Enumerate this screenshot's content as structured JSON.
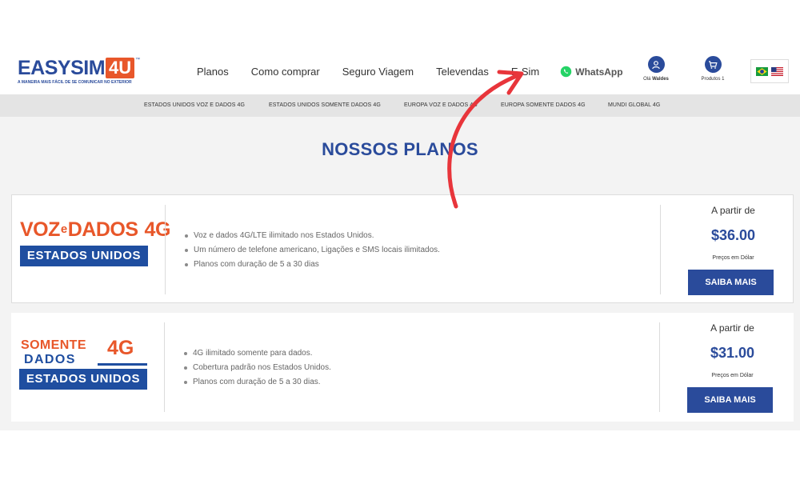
{
  "colors": {
    "brand_blue": "#2a4b9b",
    "brand_orange": "#e8572a",
    "arrow_red": "#e8353b",
    "whatsapp_green": "#25d366"
  },
  "logo": {
    "part1": "EASYSIM",
    "part2": "4U",
    "tm": "™",
    "tagline": "A MANEIRA MAIS FÁCIL DE SE COMUNICAR NO EXTERIOR"
  },
  "nav": {
    "items": [
      "Planos",
      "Como comprar",
      "Seguro Viagem",
      "Televendas",
      "E-Sim"
    ],
    "whatsapp": {
      "label": "WhatsApp",
      "icon": "whatsapp-icon"
    }
  },
  "account": {
    "greeting": "Olá",
    "name": "Waldes",
    "icon": "user-icon"
  },
  "cart": {
    "label": "Produtos 1",
    "icon": "cart-icon"
  },
  "flags": [
    "brazil-flag-icon",
    "usa-flag-icon"
  ],
  "categories": [
    "ESTADOS UNIDOS VOZ E DADOS 4G",
    "ESTADOS UNIDOS SOMENTE DADOS 4G",
    "EUROPA VOZ E DADOS 4G",
    "EUROPA SOMENTE DADOS 4G",
    "MUNDI GLOBAL 4G"
  ],
  "page_title": "NOSSOS PLANOS",
  "plans": [
    {
      "logo": {
        "voz": "VOZ",
        "e": "e",
        "dados": "DADOS",
        "g": "4G",
        "band": "ESTADOS UNIDOS"
      },
      "features": [
        "Voz e dados 4G/LTE ilimitado nos Estados Unidos.",
        "Um número de telefone americano, Ligações e SMS locais ilimitados.",
        "Planos com duração de 5 a 30 dias"
      ],
      "price_from": "A partir de",
      "price": "$36.00",
      "price_note": "Preços em Dólar",
      "button": "SAIBA MAIS"
    },
    {
      "logo": {
        "somente": "SOMENTE",
        "dados": "DADOS",
        "g": "4G",
        "band": "ESTADOS UNIDOS"
      },
      "features": [
        "4G ilimitado somente para dados.",
        "Cobertura padrão nos Estados Unidos.",
        "Planos com duração de 5 a 30 dias."
      ],
      "price_from": "A partir de",
      "price": "$31.00",
      "price_note": "Preços em Dólar",
      "button": "SAIBA MAIS"
    }
  ]
}
